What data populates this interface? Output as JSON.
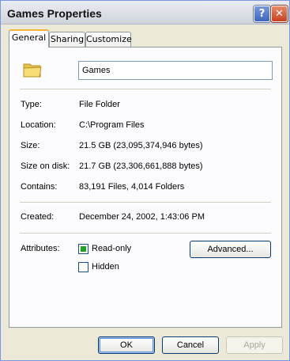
{
  "window": {
    "title": "Games Properties",
    "help_glyph": "?",
    "close_glyph": "✕"
  },
  "tabs": [
    {
      "label": "General",
      "active": true
    },
    {
      "label": "Sharing",
      "active": false
    },
    {
      "label": "Customize",
      "active": false
    }
  ],
  "general": {
    "icon": "folder-icon",
    "name": "Games",
    "type_label": "Type:",
    "type_value": "File Folder",
    "location_label": "Location:",
    "location_value": "C:\\Program Files",
    "size_label": "Size:",
    "size_value": "21.5 GB (23,095,374,946 bytes)",
    "size_on_disk_label": "Size on disk:",
    "size_on_disk_value": "21.7 GB (23,306,661,888 bytes)",
    "contains_label": "Contains:",
    "contains_value": "83,191 Files, 4,014 Folders",
    "created_label": "Created:",
    "created_value": "December 24, 2002, 1:43:06 PM",
    "attributes_label": "Attributes:",
    "read_only_label": "Read-only",
    "read_only_checked": true,
    "hidden_label": "Hidden",
    "hidden_checked": false,
    "advanced_label": "Advanced..."
  },
  "footer": {
    "ok_label": "OK",
    "cancel_label": "Cancel",
    "apply_label": "Apply"
  },
  "colors": {
    "dialog_bg": "#ece9d8",
    "tab_accent": "#f5b13a",
    "checkbox_fill": "#21a121",
    "button_border": "#003c74"
  }
}
